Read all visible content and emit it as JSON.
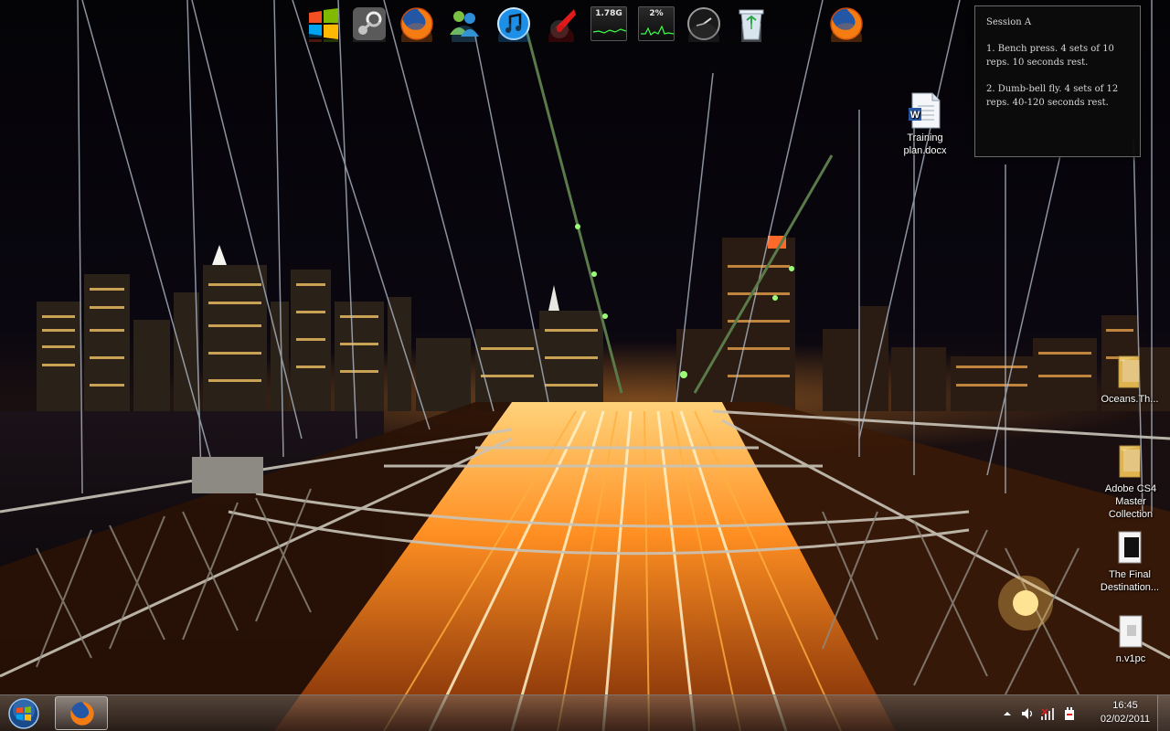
{
  "desktop": {
    "wallpaper": "night city suspension bridge with light trails",
    "icons": [
      {
        "id": "training",
        "label_line1": "Training",
        "label_line2": "plan.docx",
        "icon": "word-document-icon"
      },
      {
        "id": "oceans",
        "label_line1": "Oceans.Th...",
        "label_line2": "",
        "icon": "folder-icon"
      },
      {
        "id": "adobe",
        "label_line1": "Adobe CS4",
        "label_line2": "Master",
        "label_line3": "Collection",
        "icon": "folder-icon"
      },
      {
        "id": "final",
        "label_line1": "The Final",
        "label_line2": "Destination...",
        "icon": "video-file-icon"
      },
      {
        "id": "nv1",
        "label_line1": "n.v1pc",
        "label_line2": "",
        "icon": "file-icon"
      }
    ]
  },
  "dock": {
    "items": [
      "windows-icon",
      "steam-icon",
      "firefox-icon",
      "messenger-icon",
      "itunes-icon",
      "rocket-icon",
      "drive-meter",
      "cpu-meter",
      "clock-gadget-icon",
      "recycle-bin-icon",
      "firefox-icon"
    ],
    "drive_meter_label": "1.78G",
    "cpu_meter_label": "2%"
  },
  "note": {
    "title": "Session A",
    "line1": "1. Bench press. 4 sets of 10 reps. 10 seconds rest.",
    "line2": "2. Dumb-bell fly. 4 sets of 12 reps. 40-120 seconds rest."
  },
  "taskbar": {
    "start": "windows-start-orb",
    "pinned": [
      "firefox-icon"
    ],
    "tray_icons": [
      "show-hidden-icons-arrow",
      "volume-icon",
      "network-signal-icon",
      "power-icon"
    ],
    "time": "16:45",
    "date": "02/02/2011"
  },
  "colors": {
    "taskbar": "#3a302a",
    "note_bg": "#0c0c0c",
    "accent_orange": "#ff9a1f"
  }
}
